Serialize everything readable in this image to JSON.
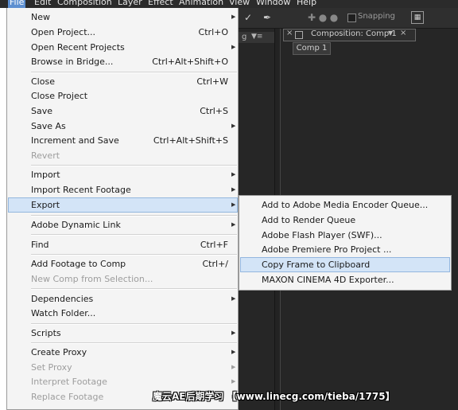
{
  "menubar": {
    "items": [
      "File",
      "Edit",
      "Composition",
      "Layer",
      "Effect",
      "Animation",
      "View",
      "Window",
      "Help"
    ]
  },
  "toolbar": {
    "snapping_label": "Snapping"
  },
  "left_panel": {
    "fragment": "g"
  },
  "composition_panel": {
    "tab_title": "Composition: Comp 1",
    "subtab_label": "Comp 1"
  },
  "file_menu": {
    "items": [
      {
        "label": "New",
        "shortcut": "",
        "submenu": true,
        "enabled": true
      },
      {
        "label": "Open Project...",
        "shortcut": "Ctrl+O",
        "submenu": false,
        "enabled": true
      },
      {
        "label": "Open Recent Projects",
        "shortcut": "",
        "submenu": true,
        "enabled": true
      },
      {
        "label": "Browse in Bridge...",
        "shortcut": "Ctrl+Alt+Shift+O",
        "submenu": false,
        "enabled": true
      },
      {
        "label": "Close",
        "shortcut": "Ctrl+W",
        "submenu": false,
        "enabled": true
      },
      {
        "label": "Close Project",
        "shortcut": "",
        "submenu": false,
        "enabled": true
      },
      {
        "label": "Save",
        "shortcut": "Ctrl+S",
        "submenu": false,
        "enabled": true
      },
      {
        "label": "Save As",
        "shortcut": "",
        "submenu": true,
        "enabled": true
      },
      {
        "label": "Increment and Save",
        "shortcut": "Ctrl+Alt+Shift+S",
        "submenu": false,
        "enabled": true
      },
      {
        "label": "Revert",
        "shortcut": "",
        "submenu": false,
        "enabled": false
      },
      {
        "label": "Import",
        "shortcut": "",
        "submenu": true,
        "enabled": true
      },
      {
        "label": "Import Recent Footage",
        "shortcut": "",
        "submenu": true,
        "enabled": true
      },
      {
        "label": "Export",
        "shortcut": "",
        "submenu": true,
        "enabled": true
      },
      {
        "label": "Adobe Dynamic Link",
        "shortcut": "",
        "submenu": true,
        "enabled": true
      },
      {
        "label": "Find",
        "shortcut": "Ctrl+F",
        "submenu": false,
        "enabled": true
      },
      {
        "label": "Add Footage to Comp",
        "shortcut": "Ctrl+/",
        "submenu": false,
        "enabled": true
      },
      {
        "label": "New Comp from Selection...",
        "shortcut": "",
        "submenu": false,
        "enabled": false
      },
      {
        "label": "Dependencies",
        "shortcut": "",
        "submenu": true,
        "enabled": true
      },
      {
        "label": "Watch Folder...",
        "shortcut": "",
        "submenu": false,
        "enabled": true
      },
      {
        "label": "Scripts",
        "shortcut": "",
        "submenu": true,
        "enabled": true
      },
      {
        "label": "Create Proxy",
        "shortcut": "",
        "submenu": true,
        "enabled": true
      },
      {
        "label": "Set Proxy",
        "shortcut": "",
        "submenu": true,
        "enabled": false
      },
      {
        "label": "Interpret Footage",
        "shortcut": "",
        "submenu": true,
        "enabled": false
      },
      {
        "label": "Replace Footage",
        "shortcut": "",
        "submenu": true,
        "enabled": false
      }
    ]
  },
  "export_submenu": {
    "items": [
      "Add to Adobe Media Encoder Queue...",
      "Add to Render Queue",
      "Adobe Flash Player (SWF)...",
      "Adobe Premiere Pro Project ...",
      "Copy Frame to Clipboard",
      "MAXON CINEMA 4D Exporter..."
    ]
  },
  "watermark": "魔云AE后期学习 【www.linecg.com/tieba/1775】"
}
